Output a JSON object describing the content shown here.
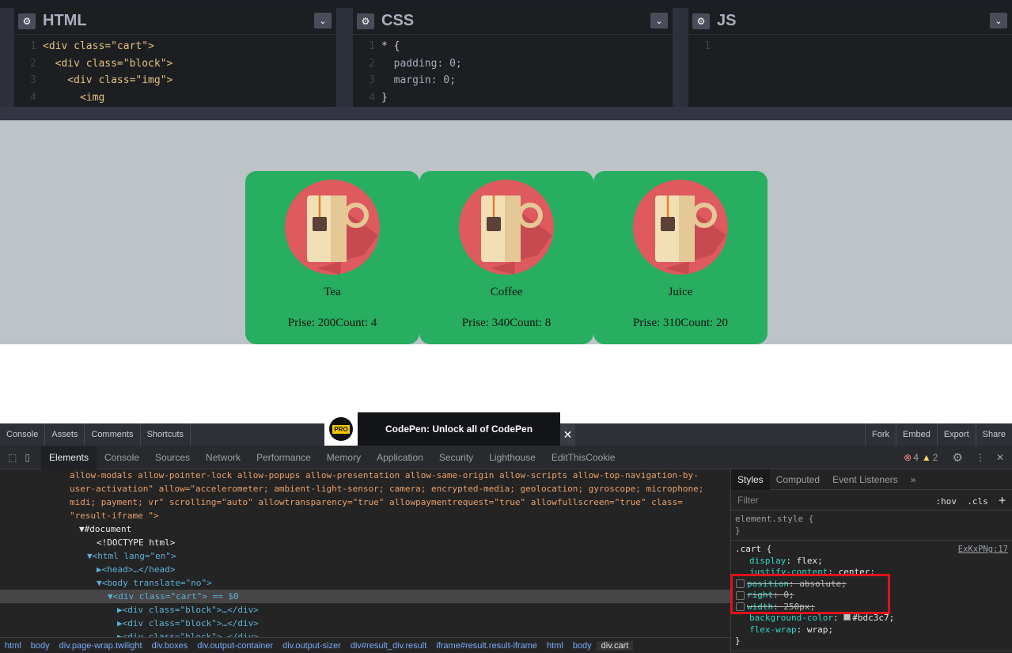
{
  "editors": [
    {
      "title": "HTML",
      "lines": [
        "<div class=\"cart\">",
        "  <div class=\"block\">",
        "    <div class=\"img\">",
        "      <img"
      ]
    },
    {
      "title": "CSS",
      "lines": [
        "* {",
        "  padding: 0;",
        "  margin: 0;",
        "}"
      ]
    },
    {
      "title": "JS",
      "lines": [
        ""
      ]
    }
  ],
  "products": [
    {
      "name": "Tea",
      "info": "Prise: 200Count: 4"
    },
    {
      "name": "Coffee",
      "info": "Prise: 340Count: 8"
    },
    {
      "name": "Juice",
      "info": "Prise: 310Count: 20"
    }
  ],
  "codepen_bar": {
    "left": [
      "Console",
      "Assets",
      "Comments",
      "Shortcuts"
    ],
    "right": [
      "Fork",
      "Embed",
      "Export",
      "Share"
    ],
    "promo": "CodePen: Unlock all of CodePen",
    "promo_badge": "PRO",
    "close": "✕"
  },
  "devtools": {
    "tabs": [
      "Elements",
      "Console",
      "Sources",
      "Network",
      "Performance",
      "Memory",
      "Application",
      "Security",
      "Lighthouse",
      "EditThisCookie"
    ],
    "errors": "4",
    "warnings": "2",
    "dom_lines": [
      "allow-modals allow-pointer-lock allow-popups allow-presentation allow-same-origin allow-scripts allow-top-navigation-by-",
      "user-activation\" allow=\"accelerometer; ambient-light-sensor; camera; encrypted-media; geolocation; gyroscope; microphone;",
      "midi; payment; vr\" scrolling=\"auto\" allowtransparency=\"true\" allowpaymentrequest=\"true\" allowfullscreen=\"true\" class=",
      "\"result-iframe \">",
      "▼#document",
      "<!DOCTYPE html>",
      "▼<html lang=\"en\">",
      "▶<head>…</head>",
      "▼<body translate=\"no\">",
      "▼<div class=\"cart\"> == $0",
      "▶<div class=\"block\">…</div>",
      "▶<div class=\"block\">…</div>",
      "▶<div class=\"block\">…</div>"
    ],
    "breadcrumbs": [
      "html",
      "body",
      "div.page-wrap.twilight",
      "div.boxes",
      "div.output-container",
      "div.output-sizer",
      "div#result_div.result",
      "iframe#result.result-iframe",
      "html",
      "body",
      "div.cart"
    ],
    "styles_tabs": [
      "Styles",
      "Computed",
      "Event Listeners",
      "»"
    ],
    "filter": "Filter",
    "hov": ":hov",
    "cls": ".cls",
    "plus": "+",
    "element_style": "element.style {",
    "close_brace": "}",
    "rule_selector": ".cart {",
    "rule_source": "ExKxPNg:17",
    "props": [
      {
        "name": "display",
        "value": "flex;",
        "disabled": false
      },
      {
        "name": "justify-content",
        "value": "center;",
        "disabled": false
      },
      {
        "name": "position",
        "value": "absolute;",
        "disabled": true
      },
      {
        "name": "right",
        "value": "0;",
        "disabled": true
      },
      {
        "name": "width",
        "value": "250px;",
        "disabled": true
      },
      {
        "name": "background-color",
        "value": "#bdc3c7;",
        "disabled": false
      },
      {
        "name": "flex-wrap",
        "value": "wrap;",
        "disabled": false
      }
    ]
  },
  "colors": {
    "card": "#27ae60",
    "preview_bg": "#bdc3c7",
    "highlight": "#e0121b"
  }
}
